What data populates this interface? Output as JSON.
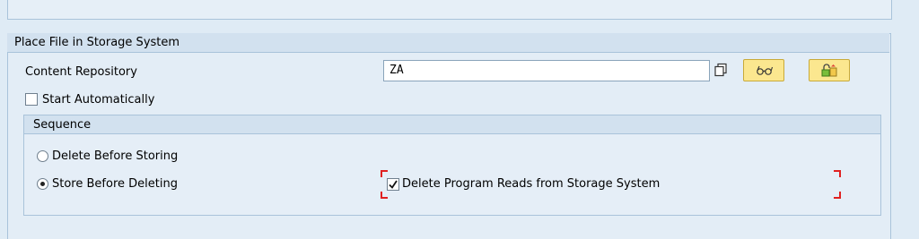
{
  "group": {
    "title": "Place File in Storage System",
    "content_repository_label": "Content Repository",
    "content_repository_value": "ZA",
    "start_automatically_label": "Start Automatically",
    "start_automatically_checked": false
  },
  "sequence": {
    "title": "Sequence",
    "delete_before_storing_label": "Delete Before Storing",
    "store_before_deleting_label": "Store Before Deleting",
    "selected": "store_before_deleting",
    "delete_program_reads_label": "Delete Program Reads from Storage System",
    "delete_program_reads_checked": true
  },
  "icons": {
    "value_help": "value-help-icon",
    "glasses": "display-glasses-icon",
    "change": "change-lock-icon"
  },
  "colors": {
    "button_bg": "#fbe78f",
    "focus_marker": "#e02020",
    "panel_bg": "#dfebf5",
    "header_bg": "#d2e1ef"
  }
}
